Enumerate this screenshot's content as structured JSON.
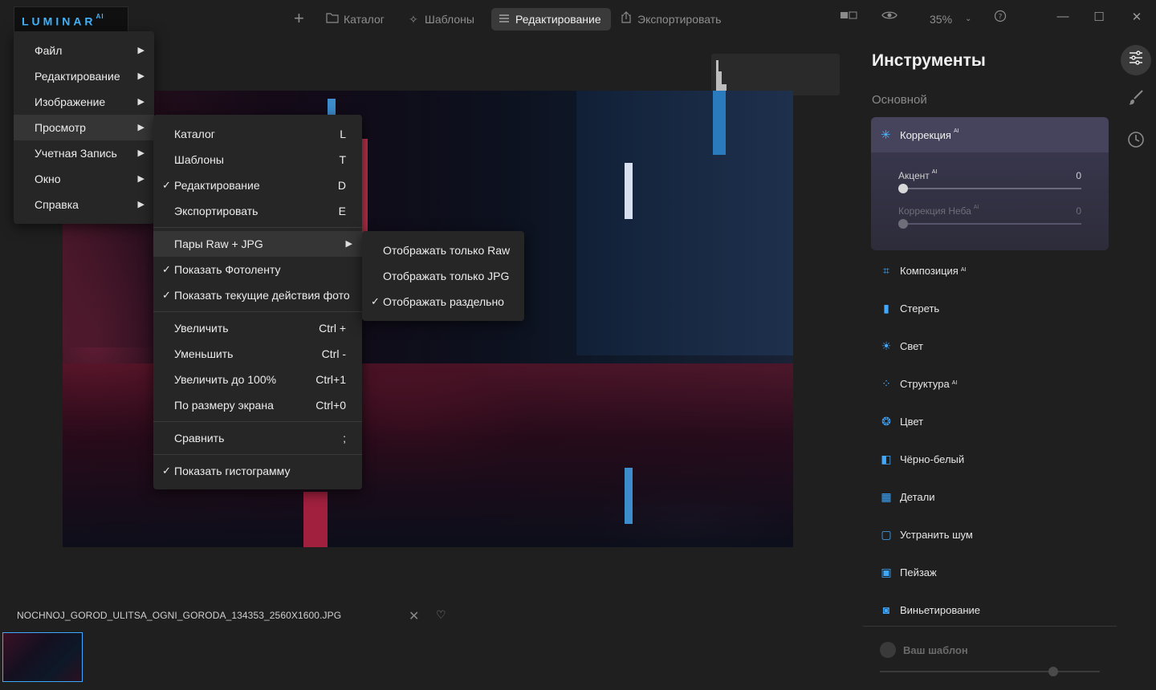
{
  "app": {
    "logo": "LUMINAR",
    "logo_sup": "AI"
  },
  "topbar": {
    "catalog": "Каталог",
    "templates": "Шаблоны",
    "edit": "Редактирование",
    "export": "Экспортировать",
    "zoom": "35%"
  },
  "main_menu": {
    "items": [
      {
        "label": "Файл"
      },
      {
        "label": "Редактирование"
      },
      {
        "label": "Изображение"
      },
      {
        "label": "Просмотр"
      },
      {
        "label": "Учетная Запись"
      },
      {
        "label": "Окно"
      },
      {
        "label": "Справка"
      }
    ],
    "highlighted_index": 3
  },
  "view_menu": {
    "items": [
      {
        "label": "Каталог",
        "shortcut": "L",
        "checked": false
      },
      {
        "label": "Шаблоны",
        "shortcut": "T",
        "checked": false
      },
      {
        "label": "Редактирование",
        "shortcut": "D",
        "checked": true
      },
      {
        "label": "Экспортировать",
        "shortcut": "E",
        "checked": false
      },
      {
        "label": "Пары Raw + JPG",
        "shortcut": "",
        "checked": false
      },
      {
        "label": "Показать Фотоленту",
        "shortcut": "",
        "checked": true
      },
      {
        "label": "Показать текущие действия фото",
        "shortcut": "",
        "checked": true
      },
      {
        "label": "Увеличить",
        "shortcut": "Ctrl +",
        "checked": false
      },
      {
        "label": "Уменьшить",
        "shortcut": "Ctrl -",
        "checked": false
      },
      {
        "label": "Увеличить до 100%",
        "shortcut": "Ctrl+1",
        "checked": false
      },
      {
        "label": "По размеру экрана",
        "shortcut": "Ctrl+0",
        "checked": false
      },
      {
        "label": "Сравнить",
        "shortcut": ";",
        "checked": false
      },
      {
        "label": "Показать гистограмму",
        "shortcut": "",
        "checked": true
      }
    ]
  },
  "raw_menu": {
    "items": [
      {
        "label": "Отображать только Raw",
        "checked": false
      },
      {
        "label": "Отображать только JPG",
        "checked": false
      },
      {
        "label": "Отображать раздельно",
        "checked": true
      }
    ]
  },
  "check_mark": "✓",
  "photo": {
    "filename": "NOCHNOJ_GOROD_ULITSA_OGNI_GORODA_134353_2560X1600.JPG"
  },
  "panel": {
    "title": "Инструменты",
    "subtitle": "Основной",
    "correction": {
      "title": "Коррекция",
      "ai_badge": "AI",
      "accent_label": "Акцент",
      "accent_value": "0",
      "sky_label": "Коррекция Неба",
      "sky_value": "0"
    },
    "tools": [
      {
        "label": "Композиция",
        "ai": "AI",
        "icon": "crop-icon"
      },
      {
        "label": "Стереть",
        "ai": "",
        "icon": "eraser-icon"
      },
      {
        "label": "Свет",
        "ai": "",
        "icon": "sun-icon"
      },
      {
        "label": "Структура",
        "ai": "AI",
        "icon": "structure-icon"
      },
      {
        "label": "Цвет",
        "ai": "",
        "icon": "color-icon"
      },
      {
        "label": "Чёрно-белый",
        "ai": "",
        "icon": "bw-icon"
      },
      {
        "label": "Детали",
        "ai": "",
        "icon": "details-icon"
      },
      {
        "label": "Устранить шум",
        "ai": "",
        "icon": "denoise-icon"
      },
      {
        "label": "Пейзаж",
        "ai": "",
        "icon": "landscape-icon"
      },
      {
        "label": "Виньетирование",
        "ai": "",
        "icon": "vignette-icon"
      }
    ],
    "template_label": "Ваш шаблон"
  }
}
